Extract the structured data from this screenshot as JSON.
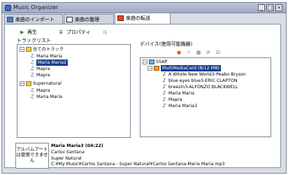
{
  "window": {
    "title": "Music Organizer"
  },
  "tabs": [
    {
      "label": "楽曲のインポート"
    },
    {
      "label": "楽曲の整理"
    },
    {
      "label": "楽曲の転送"
    }
  ],
  "toolbar": {
    "play": "再生",
    "properties": "プロパティ",
    "other": "-"
  },
  "tracks": {
    "label": "トラックリスト",
    "root": "全てのトラック",
    "items": [
      "Maria Maria",
      "Maria Maria2",
      "Mapra",
      "Mapra"
    ],
    "group": "Supernatural",
    "group_items": [
      "Mapra",
      "Maria Maria"
    ]
  },
  "device": {
    "label": "デバイス(使用可能機器)",
    "root": "SSAP",
    "card": "MultiMediaCard (8/12 MB)",
    "items": [
      "A Whole New World3-Peabo Bryson",
      "blue eyes blue3-ERIC CLAPTON",
      "breezin3-ALFONZO BLACKWELL",
      "Maria Maria",
      "Mapra",
      "Maria Maria3"
    ]
  },
  "info": {
    "art_placeholder": "アルバムアートは使用できません",
    "title": "Maria Maria3 (04:22)",
    "artist": "Carlos Santana",
    "album": "Super Natural",
    "path": "C:¥My Music¥Carlos Santana - Super Natural¥Carlos Santana-Maria Maria.mp3"
  }
}
